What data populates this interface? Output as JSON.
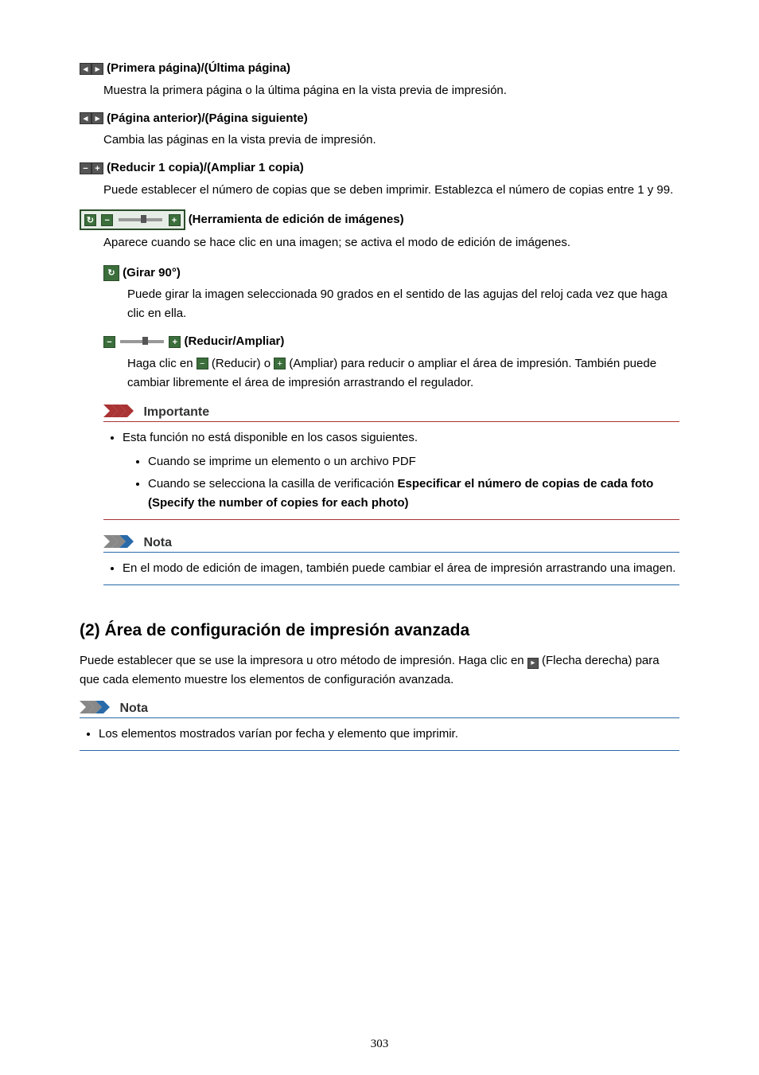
{
  "items": {
    "first_last": {
      "title": "(Primera página)/(Última página)",
      "desc": "Muestra la primera página o la última página en la vista previa de impresión."
    },
    "prev_next": {
      "title": "(Página anterior)/(Página siguiente)",
      "desc": "Cambia las páginas en la vista previa de impresión."
    },
    "reduce_enlarge_copy": {
      "title": "(Reducir 1 copia)/(Ampliar 1 copia)",
      "desc": "Puede establecer el número de copias que se deben imprimir. Establezca el número de copias entre 1 y 99."
    },
    "image_edit_tool": {
      "title": "(Herramienta de edición de imágenes)",
      "desc": "Aparece cuando se hace clic en una imagen; se activa el modo de edición de imágenes."
    },
    "rotate90": {
      "title": "(Girar 90°)",
      "desc": "Puede girar la imagen seleccionada 90 grados en el sentido de las agujas del reloj cada vez que haga clic en ella."
    },
    "reduce_enlarge": {
      "title": "(Reducir/Ampliar)",
      "desc_parts": {
        "p1": "Haga clic en ",
        "reduce": " (Reducir) o ",
        "enlarge": " (Ampliar) para reducir o ampliar el área de impresión. También puede cambiar libremente el área de impresión arrastrando el regulador."
      }
    }
  },
  "important": {
    "heading": "Importante",
    "intro": "Esta función no está disponible en los casos siguientes.",
    "bul1": "Cuando se imprime un elemento o un archivo PDF",
    "bul2_pre": "Cuando se selecciona la casilla de verificación ",
    "bul2_bold": "Especificar el número de copias de cada foto (Specify the number of copies for each photo)"
  },
  "note1": {
    "heading": "Nota",
    "text": "En el modo de edición de imagen, también puede cambiar el área de impresión arrastrando una imagen."
  },
  "section2": {
    "heading": "(2) Área de configuración de impresión avanzada",
    "desc_p1": "Puede establecer que se use la impresora u otro método de impresión. Haga clic en ",
    "desc_arrow": "(Flecha derecha)",
    "desc_p2": " para que cada elemento muestre los elementos de configuración avanzada."
  },
  "note2": {
    "heading": "Nota",
    "text": "Los elementos mostrados varían por fecha y elemento que imprimir."
  },
  "page_number": "303"
}
